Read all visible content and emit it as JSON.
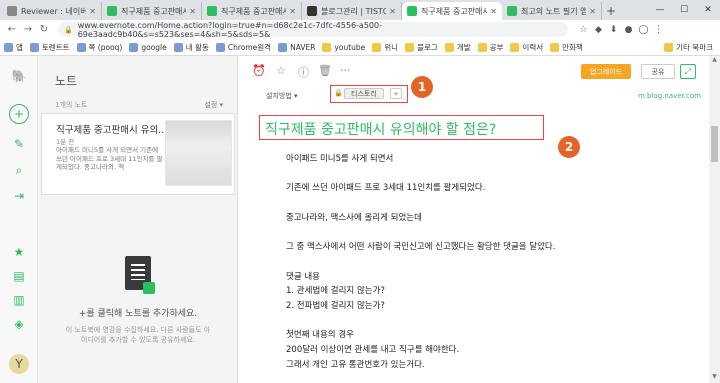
{
  "tabs": [
    {
      "title": "Reviewer : 네이버 블로그",
      "color": "#888"
    },
    {
      "title": "직구제품 중고판매시 유의해야",
      "color": "#2dbe60"
    },
    {
      "title": "직구제품 중고판매시 유의해야",
      "color": "#2dbe60"
    },
    {
      "title": "블로그관리 | TISTORY",
      "color": "#333"
    },
    {
      "title": "직구제품 중고판매시 유의해야",
      "color": "#2dbe60",
      "active": true
    },
    {
      "title": "최고의 노트 필기 앱",
      "color": "#2dbe60"
    }
  ],
  "url": "www.evernote.com/Home.action?login=true#n=d68c2e1c-7dfc-4556-a500-69e3aadc9b40&s=s523&ses=4&sh=5&sds=5&",
  "bookmarks": [
    "앱",
    "토렌트트",
    "쪽 (pooq)",
    "google",
    "내 활동",
    "Chrome원격",
    "NAVER",
    "youtube",
    "위니",
    "블로그",
    "개발",
    "공부",
    "이력서",
    "만화책"
  ],
  "bookmarks_more": "기타 북마크",
  "list": {
    "title": "노트",
    "count": "1개의 노트",
    "sort": "설정 ▾",
    "note_title": "직구제품 중고판매시 유의...",
    "note_date": "1분 전",
    "note_snippet": "아이패드 미니5를 사게 되면서 기존에 쓰던 아이패드 프로 3세대 11인치를 팔게되었다. 중고나라와, 맥",
    "empty_title": "+를 클릭해 노트를 추가하세요.",
    "empty_sub": "이 노트북에 영감을 수집하세요. 다른 사람들도 아이디어를 추가할 수 있도록 공유하세요."
  },
  "editor": {
    "notebook": "설치방법 ▾",
    "tag": "티스토리",
    "tag_add": "+",
    "source": "m.blog.naver.com",
    "upgrade": "업그레이드",
    "share": "공유",
    "title": "직구제품 중고판매시 유의해야 할 점은?",
    "badge1": "1",
    "badge2": "2"
  },
  "body": [
    "아이패드 미니5를 사게 되면서",
    "기존에 쓰던 아이패드 프로 3세대 11인치를 팔게되었다.",
    "중고나라와, 맥스사에 올리게 되었는데",
    "그 중 맥스사에서 어떤 사람이 국민신고에 신고했다는 황당한 댓글을 달았다.",
    "댓글 내용",
    "1. 관세법에 걸리지 않는가?",
    "2. 전파법에 걸리지 않는가?",
    "첫번째 내용의 경우",
    "200달러 이상이면 관세를 내고 직구를 해야한다.",
    "그래서 개인 고유 통관번호가 있는거다."
  ]
}
